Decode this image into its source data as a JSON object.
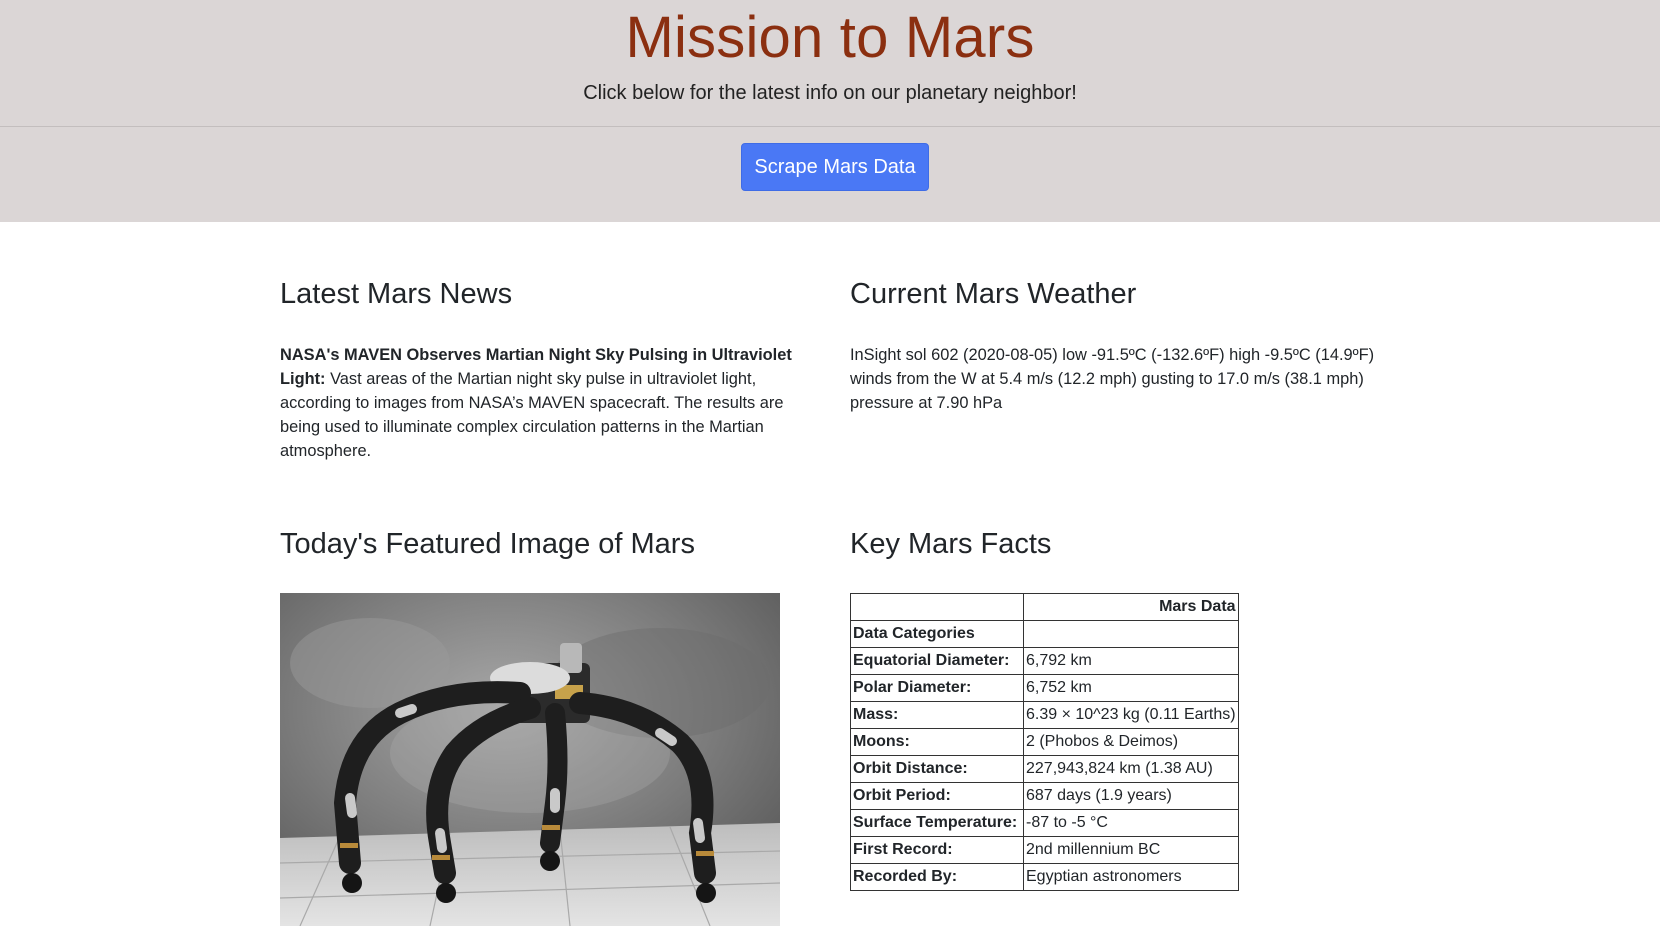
{
  "header": {
    "title": "Mission to Mars",
    "subtitle": "Click below for the latest info on our planetary neighbor!",
    "button_label": "Scrape Mars Data"
  },
  "news": {
    "heading": "Latest Mars News",
    "title": "NASA's MAVEN Observes Martian Night Sky Pulsing in Ultraviolet Light:",
    "paragraph": " Vast areas of the Martian night sky pulse in ultraviolet light, according to images from NASA’s MAVEN spacecraft. The results are being used to illuminate complex circulation patterns in the Martian atmosphere."
  },
  "weather": {
    "heading": "Current Mars Weather",
    "text": "InSight sol 602 (2020-08-05) low -91.5ºC (-132.6ºF) high -9.5ºC (14.9ºF) winds from the W at 5.4 m/s (12.2 mph) gusting to 17.0 m/s (38.1 mph) pressure at 7.90 hPa"
  },
  "featured": {
    "heading": "Today's Featured Image of Mars"
  },
  "facts": {
    "heading": "Key Mars Facts",
    "column_header": "Mars Data",
    "index_header": "Data Categories",
    "rows": [
      {
        "label": "Equatorial Diameter:",
        "value": "6,792 km"
      },
      {
        "label": "Polar Diameter:",
        "value": "6,752 km"
      },
      {
        "label": "Mass:",
        "value": "6.39 × 10^23 kg (0.11 Earths)"
      },
      {
        "label": "Moons:",
        "value": "2 (Phobos & Deimos)"
      },
      {
        "label": "Orbit Distance:",
        "value": "227,943,824 km (1.38 AU)"
      },
      {
        "label": "Orbit Period:",
        "value": "687 days (1.9 years)"
      },
      {
        "label": "Surface Temperature:",
        "value": "-87 to -5 °C"
      },
      {
        "label": "First Record:",
        "value": "2nd millennium BC"
      },
      {
        "label": "Recorded By:",
        "value": "Egyptian astronomers"
      }
    ]
  }
}
